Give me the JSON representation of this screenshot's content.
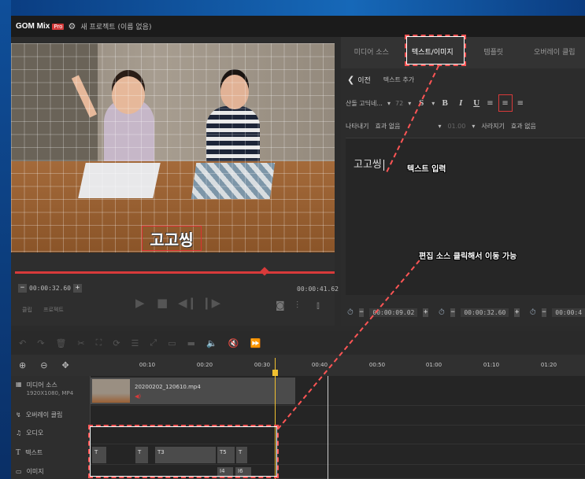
{
  "app": {
    "logo": "GOM Mix",
    "pro_badge": "Pro",
    "title": "새 프로젝트 (이름 없음)"
  },
  "preview": {
    "caption": "고고씽"
  },
  "player": {
    "current_time": "00:00:32.60",
    "total_time": "00:00:41.62",
    "left_labels": [
      "클립",
      "프로젝트"
    ]
  },
  "right_panel": {
    "tabs": [
      "미디어 소스",
      "텍스트/이미지",
      "템플릿",
      "오버레이 클립"
    ],
    "back_label": "이전",
    "add_text_label": "텍스트 추가",
    "font_name": "산돌 고딕네...",
    "font_size": "72",
    "format_buttons": [
      "S",
      "B",
      "I",
      "U"
    ],
    "appear_label": "나타내기",
    "appear_effect": "효과 없음",
    "appear_time": "01.00",
    "disappear_label": "사라지기",
    "disappear_effect": "효과 없음",
    "editor_text": "고고씽",
    "start_time": "00:00:09.02",
    "end_time": "00:00:32.60",
    "duration_time": "00:00:4"
  },
  "annotations": {
    "text_input": "텍스트 입력",
    "move_hint": "편집 소스 클릭해서 이동 가능"
  },
  "timeline": {
    "ruler_ticks": [
      "00:10",
      "00:20",
      "00:30",
      "00:40",
      "00:50",
      "01:00",
      "01:10",
      "01:20"
    ],
    "tracks": [
      {
        "label": "미디어 소스",
        "sub": "1920X1080, MP4"
      },
      {
        "label": "오버레이 클립",
        "sub": ""
      },
      {
        "label": "오디오",
        "sub": ""
      },
      {
        "label": "텍스트",
        "sub": ""
      },
      {
        "label": "이미지",
        "sub": ""
      }
    ],
    "video_clip_name": "20200202_120610.mp4",
    "text_clips": [
      "T",
      "T",
      "T3",
      "T5",
      "T"
    ],
    "image_clips": [
      "I4",
      "I6"
    ]
  },
  "colors": {
    "accent": "#d83a3a",
    "playhead": "#f0c030"
  }
}
